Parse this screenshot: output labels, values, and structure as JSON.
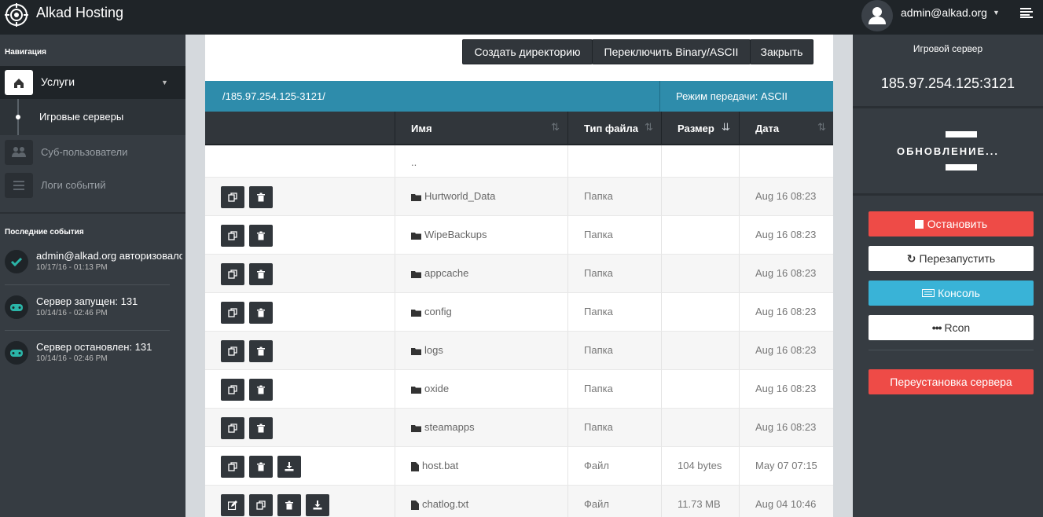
{
  "header": {
    "brand": "Alkad Hosting",
    "user": "admin@alkad.org"
  },
  "sidebar": {
    "nav_heading": "Навигация",
    "services_label": "Услуги",
    "game_servers_label": "Игровые серверы",
    "subusers_label": "Суб-пользователи",
    "event_logs_label": "Логи событий",
    "recent_heading": "Последние события",
    "events": [
      {
        "title": "admin@alkad.org авторизовался",
        "time": "10/17/16 - 01:13 PM",
        "icon": "check-icon"
      },
      {
        "title": "Сервер запущен: 131",
        "time": "10/14/16 - 02:46 PM",
        "icon": "gamepad-icon"
      },
      {
        "title": "Сервер остановлен: 131",
        "time": "10/14/16 - 02:46 PM",
        "icon": "gamepad-icon"
      }
    ]
  },
  "filemanager": {
    "toolbar": {
      "create_dir": "Создать директорию",
      "toggle_mode": "Переключить Binary/ASCII",
      "close": "Закрыть"
    },
    "path": "/185.97.254.125-3121/",
    "transfer_mode": "Режим передачи: ASCII",
    "columns": {
      "name": "Имя",
      "type": "Тип файла",
      "size": "Размер",
      "date": "Дата"
    },
    "parent_dir": "..",
    "rows": [
      {
        "name": "Hurtworld_Data",
        "type": "Папка",
        "size": "",
        "date": "Aug 16 08:23",
        "kind": "folder"
      },
      {
        "name": "WipeBackups",
        "type": "Папка",
        "size": "",
        "date": "Aug 16 08:23",
        "kind": "folder"
      },
      {
        "name": "appcache",
        "type": "Папка",
        "size": "",
        "date": "Aug 16 08:23",
        "kind": "folder"
      },
      {
        "name": "config",
        "type": "Папка",
        "size": "",
        "date": "Aug 16 08:23",
        "kind": "folder"
      },
      {
        "name": "logs",
        "type": "Папка",
        "size": "",
        "date": "Aug 16 08:23",
        "kind": "folder"
      },
      {
        "name": "oxide",
        "type": "Папка",
        "size": "",
        "date": "Aug 16 08:23",
        "kind": "folder"
      },
      {
        "name": "steamapps",
        "type": "Папка",
        "size": "",
        "date": "Aug 16 08:23",
        "kind": "folder"
      },
      {
        "name": "host.bat",
        "type": "Файл",
        "size": "104 bytes",
        "date": "May 07 07:15",
        "kind": "file"
      },
      {
        "name": "chatlog.txt",
        "type": "Файл",
        "size": "11.73 MB",
        "date": "Aug 04 10:46",
        "kind": "textfile"
      }
    ]
  },
  "right": {
    "title": "Игровой сервер",
    "ip": "185.97.254.125:3121",
    "status": "ОБНОВЛЕНИЕ...",
    "stop": "Остановить",
    "restart": "Перезапустить",
    "console": "Консоль",
    "rcon": "Rcon",
    "reinstall": "Переустановка сервера"
  },
  "colors": {
    "accent_teal": "#2e8cab",
    "danger_red": "#ee4b47",
    "info_blue": "#39b3d7",
    "dark": "#1f2428"
  }
}
